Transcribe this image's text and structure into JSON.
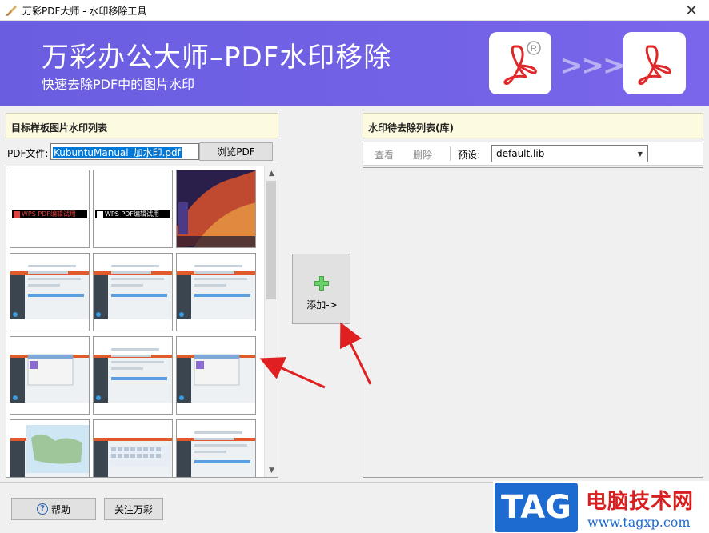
{
  "window": {
    "title": "万彩PDF大师 - 水印移除工具",
    "close_glyph": "✕",
    "app_icon": "brush-app-icon"
  },
  "banner": {
    "title": "万彩办公大师–PDF水印移除",
    "subtitle": "快速去除PDF中的图片水印",
    "arrows": ">>>",
    "icons": [
      "pdf-registered-icon",
      "pdf-icon"
    ],
    "background_color": "#7262e6"
  },
  "left_panel": {
    "header": "目标样板图片水印列表",
    "pdf_label": "PDF文件:",
    "pdf_value": "KubuntuManual_加水印.pdf",
    "browse_label": "浏览PDF",
    "thumbnails": [
      {
        "kind": "wps",
        "band_text": "WPS PDF编辑试用",
        "band_color": "#e24040"
      },
      {
        "kind": "wps",
        "band_text": "WPS PDF编辑试用",
        "band_color": "#ffffff"
      },
      {
        "kind": "wallpaper"
      },
      {
        "kind": "screenshot"
      },
      {
        "kind": "screenshot"
      },
      {
        "kind": "screenshot"
      },
      {
        "kind": "screenshot-dialog"
      },
      {
        "kind": "screenshot"
      },
      {
        "kind": "screenshot-dialog"
      },
      {
        "kind": "screenshot-map"
      },
      {
        "kind": "screenshot-keyboard"
      },
      {
        "kind": "screenshot"
      }
    ]
  },
  "center": {
    "add_label": "添加->"
  },
  "right_panel": {
    "header": "水印待去除列表(库)",
    "view_label": "查看",
    "delete_label": "删除",
    "preset_label": "预设:",
    "preset_value": "default.lib"
  },
  "footer": {
    "help_label": "帮助",
    "follow_label": "关注万彩"
  },
  "watermark": {
    "tag": "TAG",
    "site_name": "电脑技术网",
    "url": "www.tagxp.com"
  },
  "colors": {
    "accent_arrow": "#e02020",
    "pdf_red": "#e0282a",
    "header_bg": "#fcfadf",
    "selection": "#0078d7"
  }
}
